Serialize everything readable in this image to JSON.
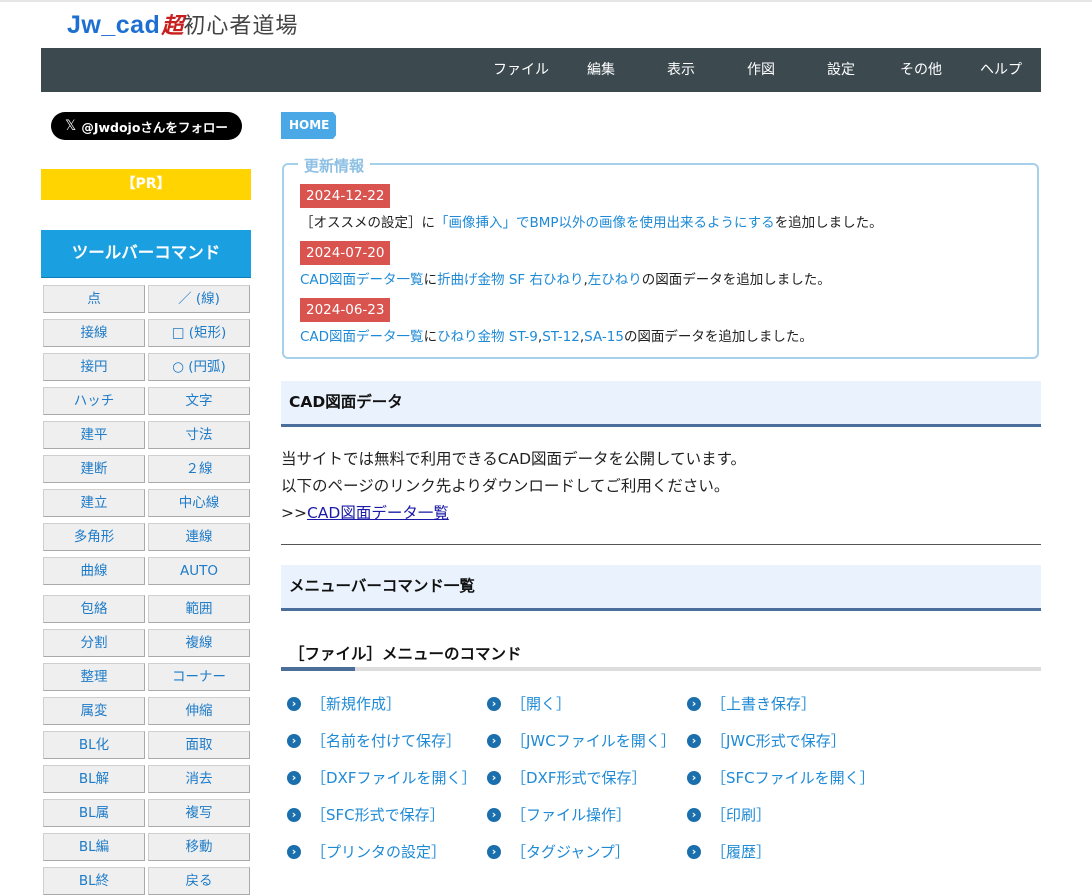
{
  "header": {
    "logo_part1": "Jw_cad",
    "logo_part2": "超",
    "logo_part3": "初心者道場",
    "menu": [
      "ファイル",
      "編集",
      "表示",
      "作図",
      "設定",
      "その他",
      "ヘルプ"
    ]
  },
  "sidebar": {
    "follow_button": "@Jwdojoさんをフォロー",
    "x_logo": "𝕏",
    "pr_label": "【PR】",
    "toolbar_heading": "ツールバーコマンド",
    "commands": [
      [
        "点",
        "／ (線)"
      ],
      [
        "接線",
        "□ (矩形)"
      ],
      [
        "接円",
        "○ (円弧)"
      ],
      [
        "ハッチ",
        "文字"
      ],
      [
        "建平",
        "寸法"
      ],
      [
        "建断",
        "２線"
      ],
      [
        "建立",
        "中心線"
      ],
      [
        "多角形",
        "連線"
      ],
      [
        "曲線",
        "AUTO"
      ],
      [
        "包絡",
        "範囲"
      ],
      [
        "分割",
        "複線"
      ],
      [
        "整理",
        "コーナー"
      ],
      [
        "属変",
        "伸縮"
      ],
      [
        "BL化",
        "面取"
      ],
      [
        "BL解",
        "消去"
      ],
      [
        "BL属",
        "複写"
      ],
      [
        "BL編",
        "移動"
      ],
      [
        "BL終",
        "戻る"
      ]
    ]
  },
  "breadcrumb": {
    "home": "HOME"
  },
  "news": {
    "legend": "更新情報",
    "entries": [
      {
        "date": "2024-12-22",
        "parts": [
          {
            "text": "［オススメの設定］に",
            "link": false
          },
          {
            "text": "「画像挿入」でBMP以外の画像を使用出来るようにする",
            "link": true
          },
          {
            "text": "を追加しました。",
            "link": false
          }
        ]
      },
      {
        "date": "2024-07-20",
        "parts": [
          {
            "text": "CAD図面データ一覧",
            "link": true
          },
          {
            "text": "に",
            "link": false
          },
          {
            "text": "折曲げ金物 SF 右ひねり",
            "link": true
          },
          {
            "text": ",",
            "link": false
          },
          {
            "text": "左ひねり",
            "link": true
          },
          {
            "text": "の図面データを追加しました。",
            "link": false
          }
        ]
      },
      {
        "date": "2024-06-23",
        "parts": [
          {
            "text": "CAD図面データ一覧",
            "link": true
          },
          {
            "text": "に",
            "link": false
          },
          {
            "text": "ひねり金物 ST-9",
            "link": true
          },
          {
            "text": ",",
            "link": false
          },
          {
            "text": "ST-12",
            "link": true
          },
          {
            "text": ",",
            "link": false
          },
          {
            "text": "SA-15",
            "link": true
          },
          {
            "text": "の図面データを追加しました。",
            "link": false
          }
        ]
      }
    ]
  },
  "cad_section": {
    "title": "CAD図面データ",
    "line1": "当サイトでは無料で利用できるCAD図面データを公開しています。",
    "line2": "以下のページのリンク先よりダウンロードしてご利用ください。",
    "line3_prefix": ">>",
    "line3_link": "CAD図面データ一覧"
  },
  "menubar_section": {
    "title": "メニューバーコマンド一覧",
    "file_heading": "［ファイル］メニューのコマンド",
    "bullet_icon": "›",
    "file_commands": [
      "［新規作成］",
      "［開く］",
      "［上書き保存］",
      "［名前を付けて保存］",
      "［JWCファイルを開く］",
      "［JWC形式で保存］",
      "［DXFファイルを開く］",
      "［DXF形式で保存］",
      "［SFCファイルを開く］",
      "［SFC形式で保存］",
      "［ファイル操作］",
      "［印刷］",
      "［プリンタの設定］",
      "［タグジャンプ］",
      "［履歴］"
    ]
  }
}
